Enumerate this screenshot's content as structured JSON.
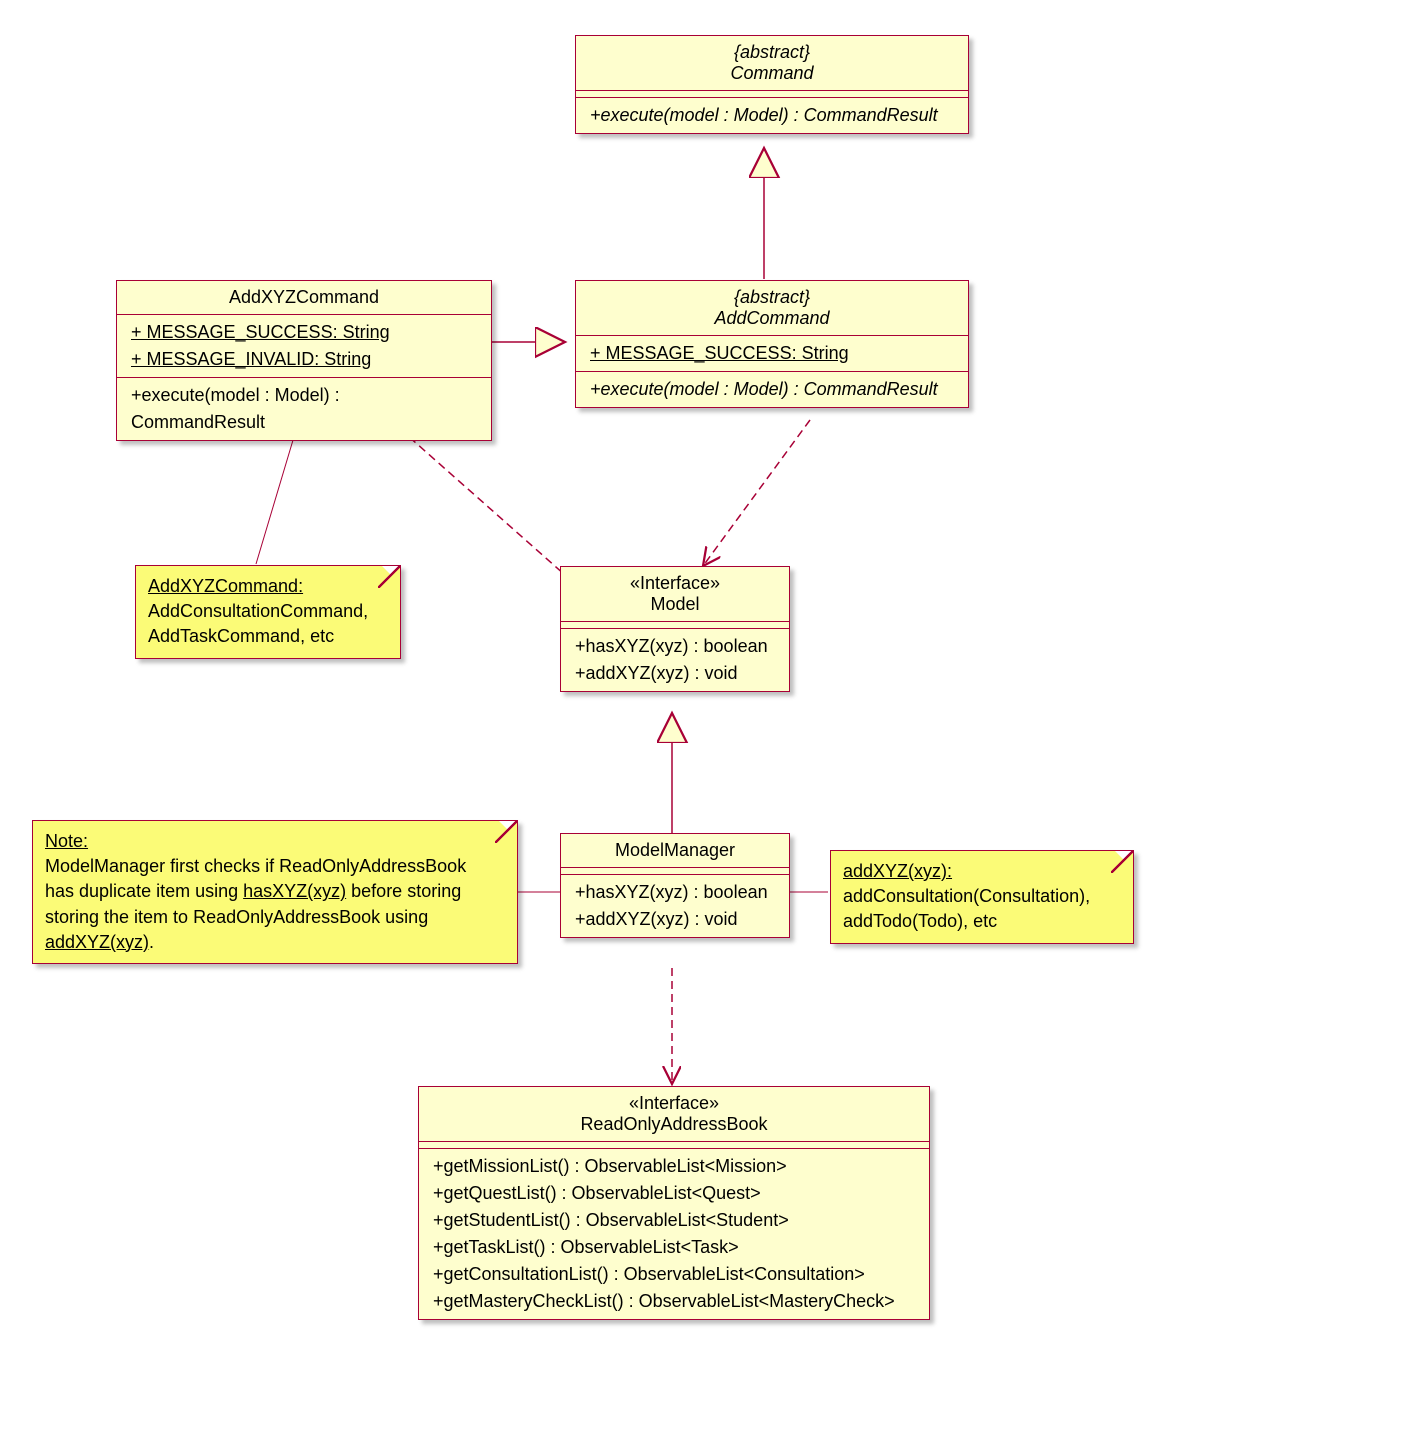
{
  "command": {
    "stereotype": "{abstract}",
    "name": "Command",
    "method": "+execute(model : Model) : CommandResult"
  },
  "addCommand": {
    "stereotype": "{abstract}",
    "name": "AddCommand",
    "attr": "+ MESSAGE_SUCCESS: String",
    "method": "+execute(model : Model) : CommandResult"
  },
  "addXYZ": {
    "name": "AddXYZCommand",
    "attr1": "+ MESSAGE_SUCCESS: String",
    "attr2": "+ MESSAGE_INVALID: String",
    "method": "+execute(model : Model) : CommandResult"
  },
  "model": {
    "stereotype": "«Interface»",
    "name": "Model",
    "m1": "+hasXYZ(xyz) : boolean",
    "m2": "+addXYZ(xyz) : void"
  },
  "modelManager": {
    "name": "ModelManager",
    "m1": "+hasXYZ(xyz) : boolean",
    "m2": "+addXYZ(xyz) : void"
  },
  "roab": {
    "stereotype": "«Interface»",
    "name": "ReadOnlyAddressBook",
    "m1": "+getMissionList() : ObservableList<Mission>",
    "m2": "+getQuestList() : ObservableList<Quest>",
    "m3": "+getStudentList() : ObservableList<Student>",
    "m4": "+getTaskList() : ObservableList<Task>",
    "m5": "+getConsultationList() : ObservableList<Consultation>",
    "m6": "+getMasteryCheckList() : ObservableList<MasteryCheck>"
  },
  "notes": {
    "n1_t": "AddXYZCommand:",
    "n1_a": "AddConsultationCommand,",
    "n1_b": "AddTaskCommand, etc",
    "n2_t": "Note:",
    "n2_a": "ModelManager first checks if ReadOnlyAddressBook",
    "n2_b": "has duplicate item using ",
    "n2_b2": "hasXYZ(xyz)",
    "n2_b3": " before storing",
    "n2_c": " storing the item to ReadOnlyAddressBook using",
    "n2_d": "addXYZ(xyz)",
    "n2_e": ".",
    "n3_t": "addXYZ(xyz):",
    "n3_a": "addConsultation(Consultation),",
    "n3_b": "addTodo(Todo), etc"
  }
}
